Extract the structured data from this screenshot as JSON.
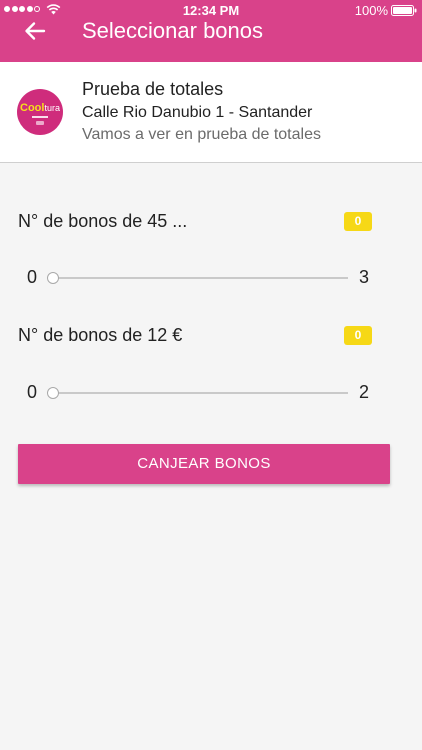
{
  "status_bar": {
    "signal_level": 4,
    "signal_max": 5,
    "wifi_icon": "wifi-icon",
    "time": "12:34 PM",
    "battery_percent": "100%",
    "battery_icon": "battery-full-icon"
  },
  "header": {
    "back_icon": "arrow-left-icon",
    "title": "Seleccionar bonos"
  },
  "venue": {
    "logo": {
      "text_primary": "Cool",
      "text_secondary": "tura"
    },
    "name": "Prueba de totales",
    "address": "Calle Rio Danubio 1 - Santander",
    "description": "Vamos a ver en prueba de totales"
  },
  "bonos": [
    {
      "label": "N° de bonos de 45 ...",
      "selected_count": "0",
      "slider": {
        "min": "0",
        "max": "3",
        "value": 0
      }
    },
    {
      "label": "N° de bonos de 12 €",
      "selected_count": "0",
      "slider": {
        "min": "0",
        "max": "2",
        "value": 0
      }
    }
  ],
  "redeem_button": {
    "label": "CANJEAR BONOS"
  },
  "colors": {
    "brand": "#d9428a",
    "badge": "#f6d816",
    "background": "#f5f5f5"
  }
}
